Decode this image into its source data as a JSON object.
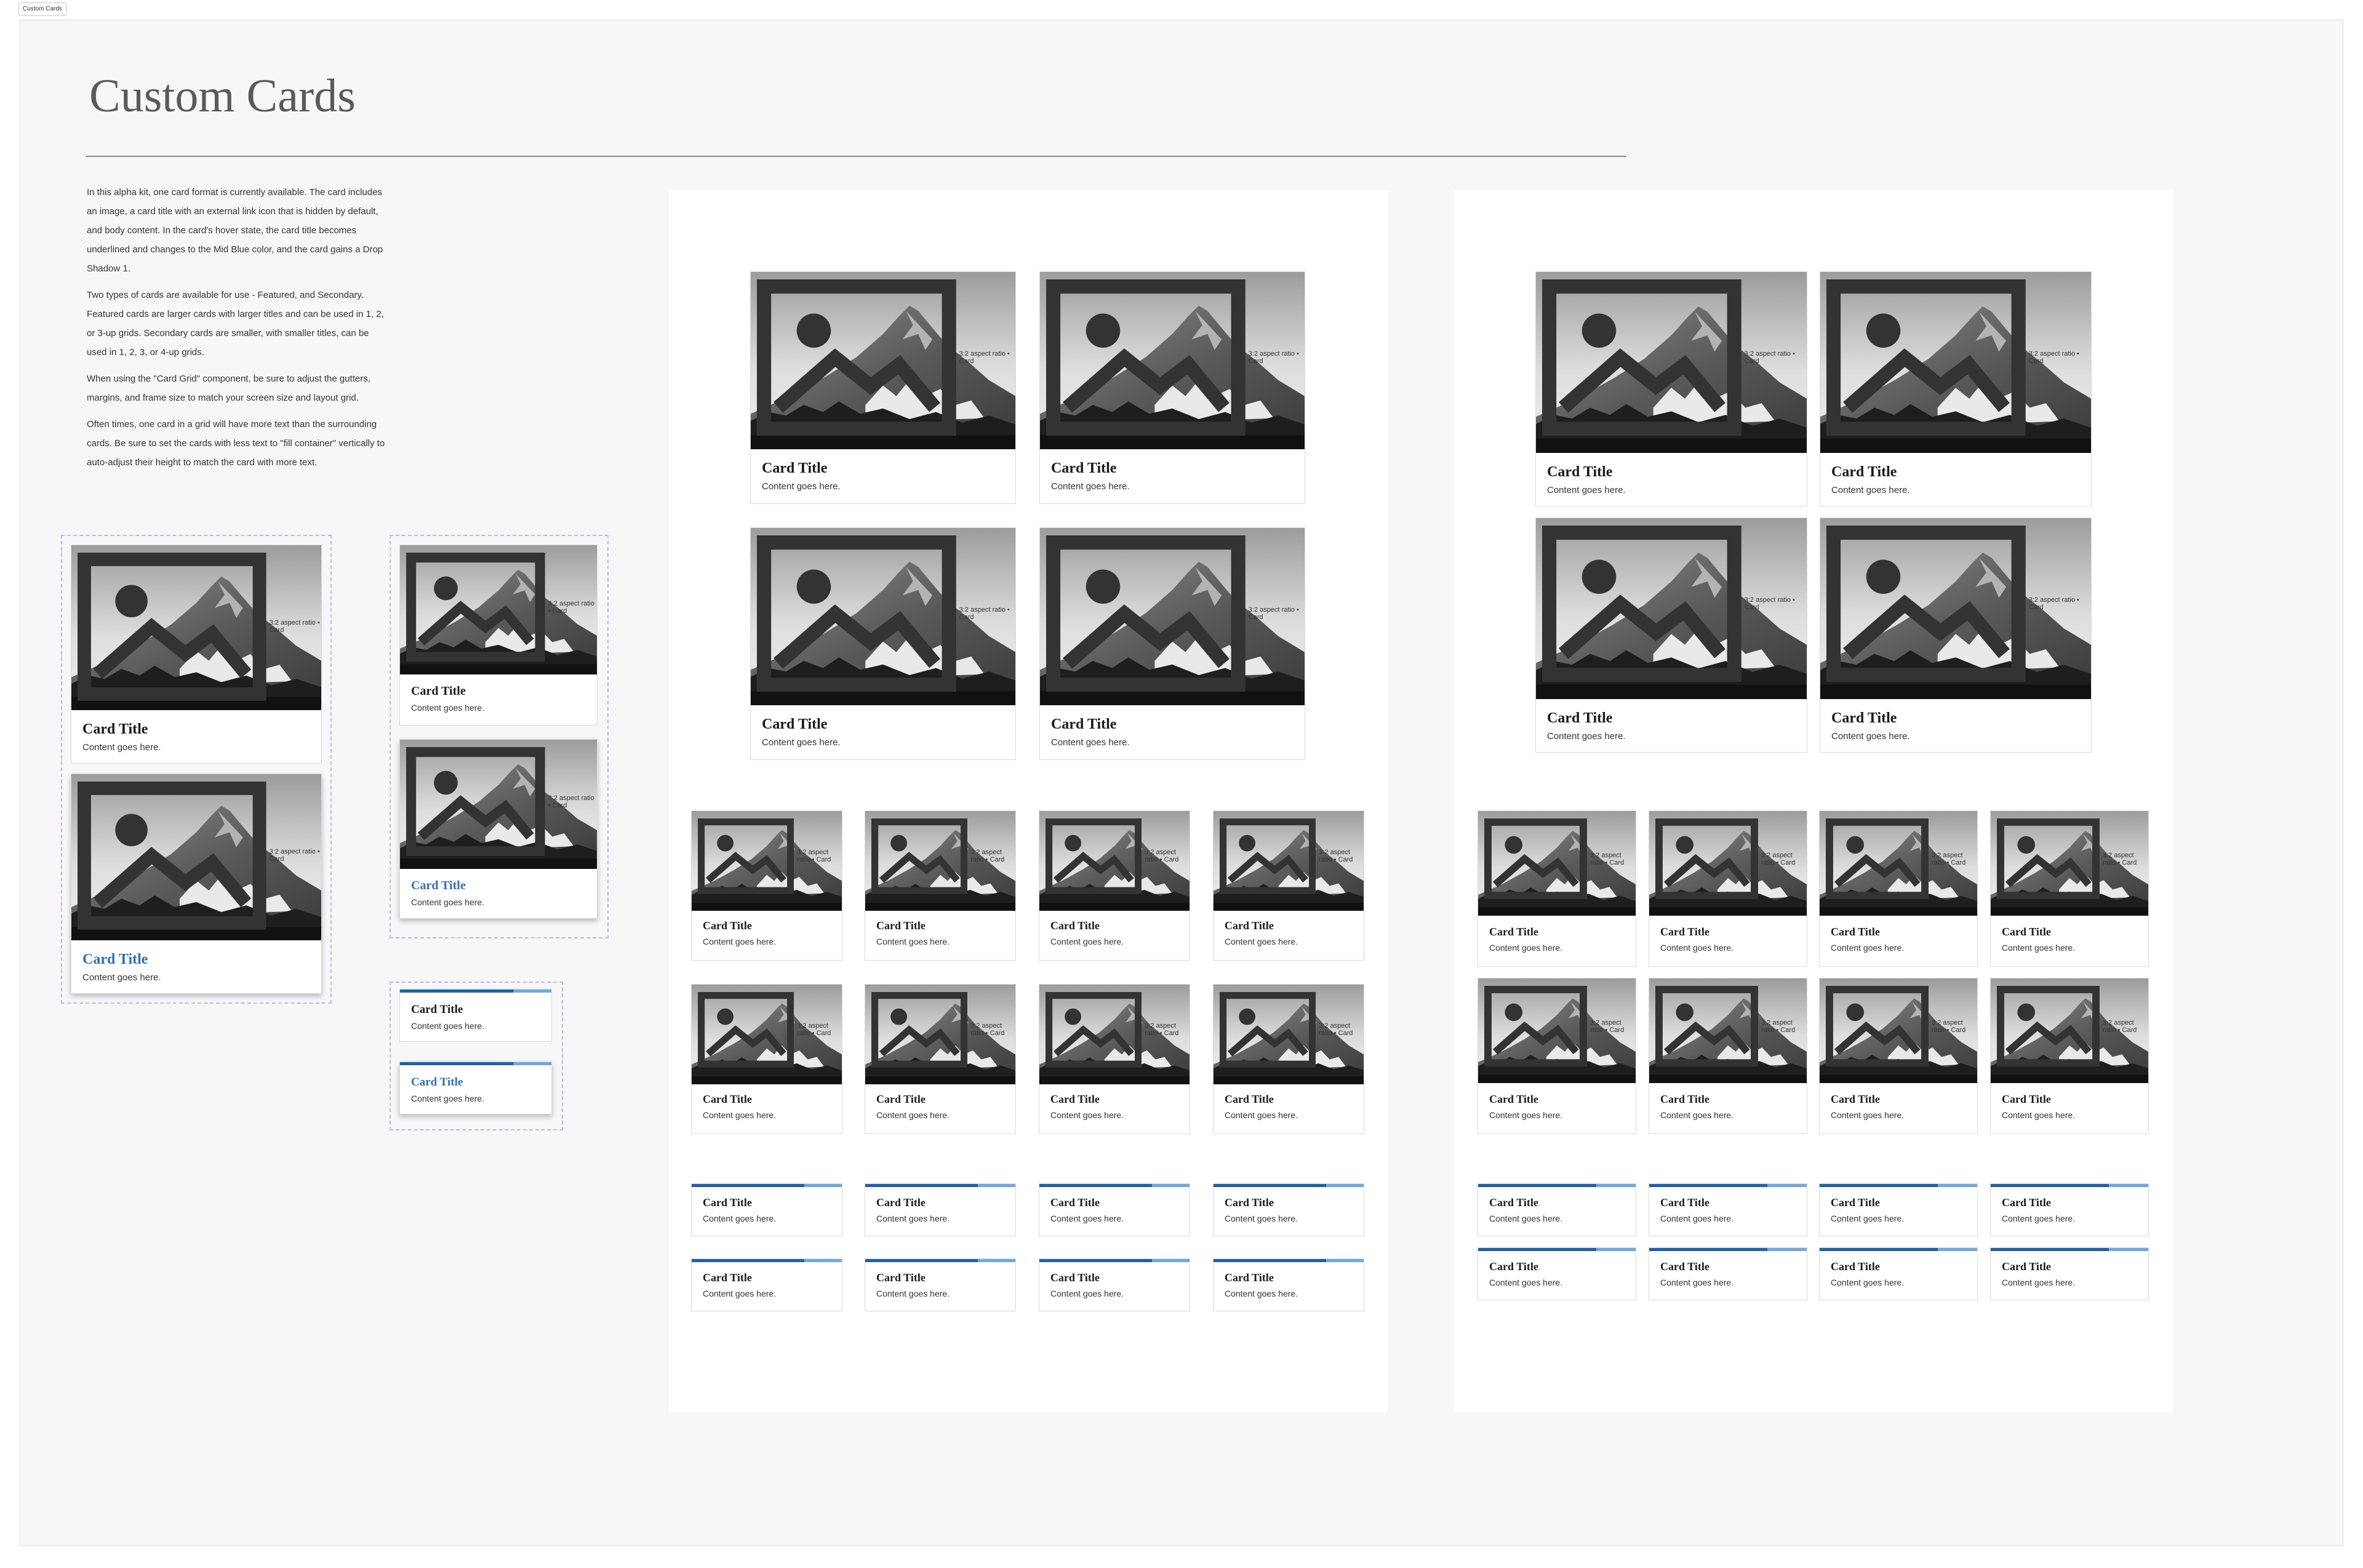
{
  "frame_tab": "Custom Cards",
  "page_title": "Custom Cards",
  "description": [
    "In this alpha kit, one card format is currently available. The card includes an image, a card title with an external link icon that is hidden by default, and body content. In the card's hover state, the card title becomes underlined and changes to the Mid Blue color, and the card gains a Drop Shadow 1.",
    "Two types of cards are available for use - Featured, and Secondary. Featured cards are larger cards with larger titles and can be used in 1, 2, or 3-up grids. Secondary cards are smaller, with smaller titles, can be used in 1, 2, 3, or 4-up grids.",
    "When using the \"Card Grid\" component, be sure to adjust the gutters, margins, and frame size to match your screen size and layout grid.",
    "Often times, one card in a grid will have more text than the surrounding cards. Be sure to set the cards with less text to \"fill container\" vertically to auto-adjust their height to match the card with more text."
  ],
  "card": {
    "image_tag": "3:2 aspect ratio • Card",
    "title": "Card Title",
    "body": "Content goes here."
  },
  "colors": {
    "mid_blue": "#2f6fb8",
    "accent_dark": "#1f5fae",
    "accent_light": "#6ea8e6",
    "variant_outline": "#c7b4ee"
  }
}
